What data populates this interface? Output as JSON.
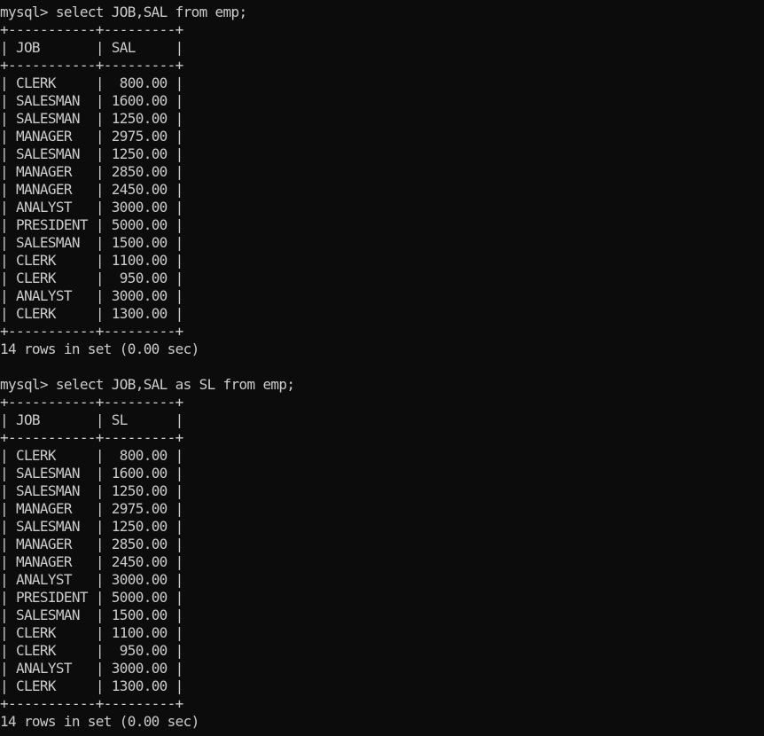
{
  "colors": {
    "background": "#0c0c0c",
    "foreground": "#cccccc"
  },
  "blocks": [
    {
      "prompt": "mysql>",
      "command": "select JOB,SAL from emp;",
      "columns": [
        "JOB",
        "SAL"
      ],
      "rows": [
        [
          "CLERK",
          "800.00"
        ],
        [
          "SALESMAN",
          "1600.00"
        ],
        [
          "SALESMAN",
          "1250.00"
        ],
        [
          "MANAGER",
          "2975.00"
        ],
        [
          "SALESMAN",
          "1250.00"
        ],
        [
          "MANAGER",
          "2850.00"
        ],
        [
          "MANAGER",
          "2450.00"
        ],
        [
          "ANALYST",
          "3000.00"
        ],
        [
          "PRESIDENT",
          "5000.00"
        ],
        [
          "SALESMAN",
          "1500.00"
        ],
        [
          "CLERK",
          "1100.00"
        ],
        [
          "CLERK",
          "950.00"
        ],
        [
          "ANALYST",
          "3000.00"
        ],
        [
          "CLERK",
          "1300.00"
        ]
      ],
      "summary": "14 rows in set (0.00 sec)"
    },
    {
      "prompt": "mysql>",
      "command": "select JOB,SAL as SL from emp;",
      "columns": [
        "JOB",
        "SL"
      ],
      "rows": [
        [
          "CLERK",
          "800.00"
        ],
        [
          "SALESMAN",
          "1600.00"
        ],
        [
          "SALESMAN",
          "1250.00"
        ],
        [
          "MANAGER",
          "2975.00"
        ],
        [
          "SALESMAN",
          "1250.00"
        ],
        [
          "MANAGER",
          "2850.00"
        ],
        [
          "MANAGER",
          "2450.00"
        ],
        [
          "ANALYST",
          "3000.00"
        ],
        [
          "PRESIDENT",
          "5000.00"
        ],
        [
          "SALESMAN",
          "1500.00"
        ],
        [
          "CLERK",
          "1100.00"
        ],
        [
          "CLERK",
          "950.00"
        ],
        [
          "ANALYST",
          "3000.00"
        ],
        [
          "CLERK",
          "1300.00"
        ]
      ],
      "summary": "14 rows in set (0.00 sec)"
    }
  ]
}
